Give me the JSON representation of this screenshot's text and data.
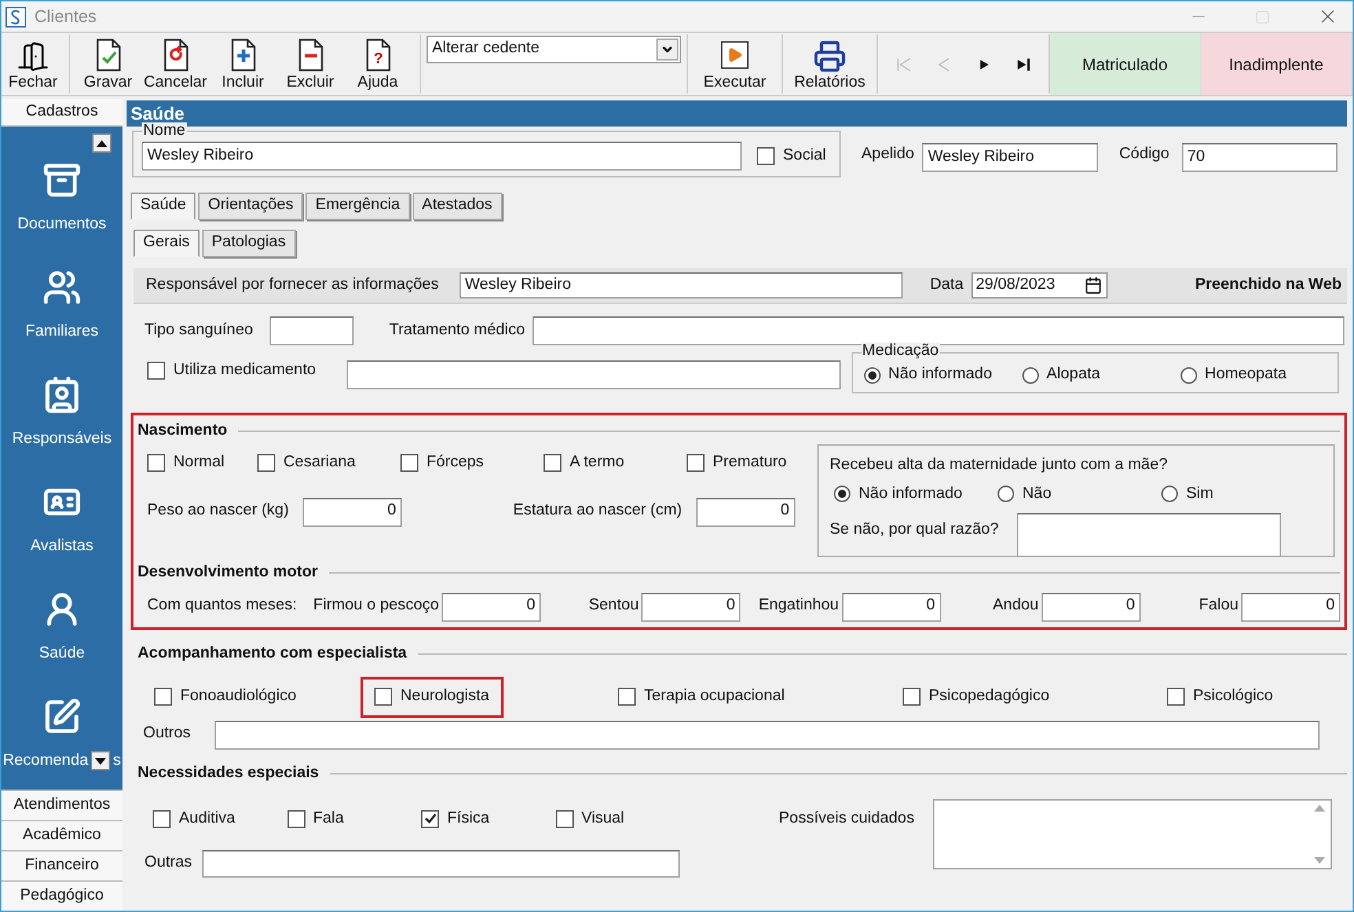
{
  "window": {
    "title": "Clientes"
  },
  "toolbar": {
    "buttons": [
      {
        "label": "Fechar",
        "kind": "door"
      },
      {
        "label": "Gravar",
        "kind": "check"
      },
      {
        "label": "Cancelar",
        "kind": "undo"
      },
      {
        "label": "Incluir",
        "kind": "plus"
      },
      {
        "label": "Excluir",
        "kind": "minus"
      },
      {
        "label": "Ajuda",
        "kind": "help",
        "symbol": "?"
      }
    ],
    "action_select": {
      "value": "Alterar cedente"
    },
    "run_buttons": [
      {
        "label": "Executar",
        "kind": "play"
      },
      {
        "label": "Relatórios",
        "kind": "printer"
      }
    ],
    "navigation": [
      {
        "kind": "first",
        "disabled": true
      },
      {
        "kind": "prev",
        "disabled": true
      },
      {
        "kind": "next",
        "disabled": false
      },
      {
        "kind": "last",
        "disabled": false
      }
    ],
    "status_buttons": [
      {
        "label": "Matriculado",
        "color": "#d6ecd9"
      },
      {
        "label": "Inadimplente",
        "color": "#f6d7db"
      }
    ]
  },
  "sidebar": {
    "header": "Cadastros",
    "items": [
      {
        "label": "Documentos",
        "kind": "archive"
      },
      {
        "label": "Familiares",
        "kind": "users"
      },
      {
        "label": "Responsáveis",
        "kind": "contact"
      },
      {
        "label": "Avalistas",
        "kind": "card"
      },
      {
        "label": "Saúde",
        "kind": "medic"
      },
      {
        "label": "Recomenda",
        "label_tail": "s",
        "kind": "edit"
      }
    ],
    "sections": [
      "Atendimentos",
      "Acadêmico",
      "Financeiro",
      "Pedagógico"
    ]
  },
  "form": {
    "title": "Saúde",
    "name": {
      "label": "Nome",
      "value": "Wesley Ribeiro"
    },
    "social": {
      "label": "Social",
      "checked": false
    },
    "nickname": {
      "label": "Apelido",
      "value": "Wesley Ribeiro"
    },
    "code": {
      "label": "Código",
      "value": "70"
    },
    "tabs": [
      {
        "label": "Saúde",
        "selected": true
      },
      {
        "label": "Orientações",
        "selected": false
      },
      {
        "label": "Emergência",
        "selected": false
      },
      {
        "label": "Atestados",
        "selected": false
      }
    ],
    "subtabs": [
      {
        "label": "Gerais",
        "selected": true
      },
      {
        "label": "Patologias",
        "selected": false
      }
    ],
    "informant": {
      "label": "Responsável por fornecer as informações",
      "value": "Wesley Ribeiro"
    },
    "date": {
      "label": "Data",
      "value": "29/08/2023"
    },
    "web_note": "Preenchido na Web",
    "blood_type": {
      "label": "Tipo sanguíneo"
    },
    "treatment": {
      "label": "Tratamento médico"
    },
    "medication_use": {
      "label": "Utiliza medicamento",
      "checked": false
    },
    "medication": {
      "label": "Medicação",
      "options": [
        {
          "label": "Não informado",
          "selected": true
        },
        {
          "label": "Alopata",
          "selected": false
        },
        {
          "label": "Homeopata",
          "selected": false
        }
      ]
    },
    "birth": {
      "title": "Nascimento",
      "types": [
        {
          "label": "Normal",
          "checked": false
        },
        {
          "label": "Cesariana",
          "checked": false
        },
        {
          "label": "Fórceps",
          "checked": false
        },
        {
          "label": "A termo",
          "checked": false
        },
        {
          "label": "Prematuro",
          "checked": false
        }
      ],
      "weight": {
        "label": "Peso ao nascer (kg)",
        "value": "0"
      },
      "height": {
        "label": "Estatura ao nascer (cm)",
        "value": "0"
      },
      "discharge": {
        "question": "Recebeu alta da maternidade junto com a mãe?",
        "options": [
          {
            "label": "Não informado",
            "selected": true
          },
          {
            "label": "Não",
            "selected": false
          },
          {
            "label": "Sim",
            "selected": false
          }
        ],
        "reason_label": "Se não, por qual razão?"
      }
    },
    "motor": {
      "title": "Desenvolvimento motor",
      "prompt": "Com quantos meses:",
      "milestones": [
        {
          "label": "Firmou o pescoço",
          "value": "0"
        },
        {
          "label": "Sentou",
          "value": "0"
        },
        {
          "label": "Engatinhou",
          "value": "0"
        },
        {
          "label": "Andou",
          "value": "0"
        },
        {
          "label": "Falou",
          "value": "0"
        }
      ]
    },
    "specialists": {
      "title": "Acompanhamento com especialista",
      "options": [
        {
          "label": "Fonoaudiológico",
          "checked": false,
          "highlighted": false
        },
        {
          "label": "Neurologista",
          "checked": false,
          "highlighted": true
        },
        {
          "label": "Terapia ocupacional",
          "checked": false,
          "highlighted": false
        },
        {
          "label": "Psicopedagógico",
          "checked": false,
          "highlighted": false
        },
        {
          "label": "Psicológico",
          "checked": false,
          "highlighted": false
        }
      ],
      "others_label": "Outros"
    },
    "special_needs": {
      "title": "Necessidades especiais",
      "options": [
        {
          "label": "Auditiva",
          "checked": false
        },
        {
          "label": "Fala",
          "checked": false
        },
        {
          "label": "Física",
          "checked": true
        },
        {
          "label": "Visual",
          "checked": false
        }
      ],
      "others_label": "Outras",
      "care_label": "Possíveis cuidados"
    }
  }
}
